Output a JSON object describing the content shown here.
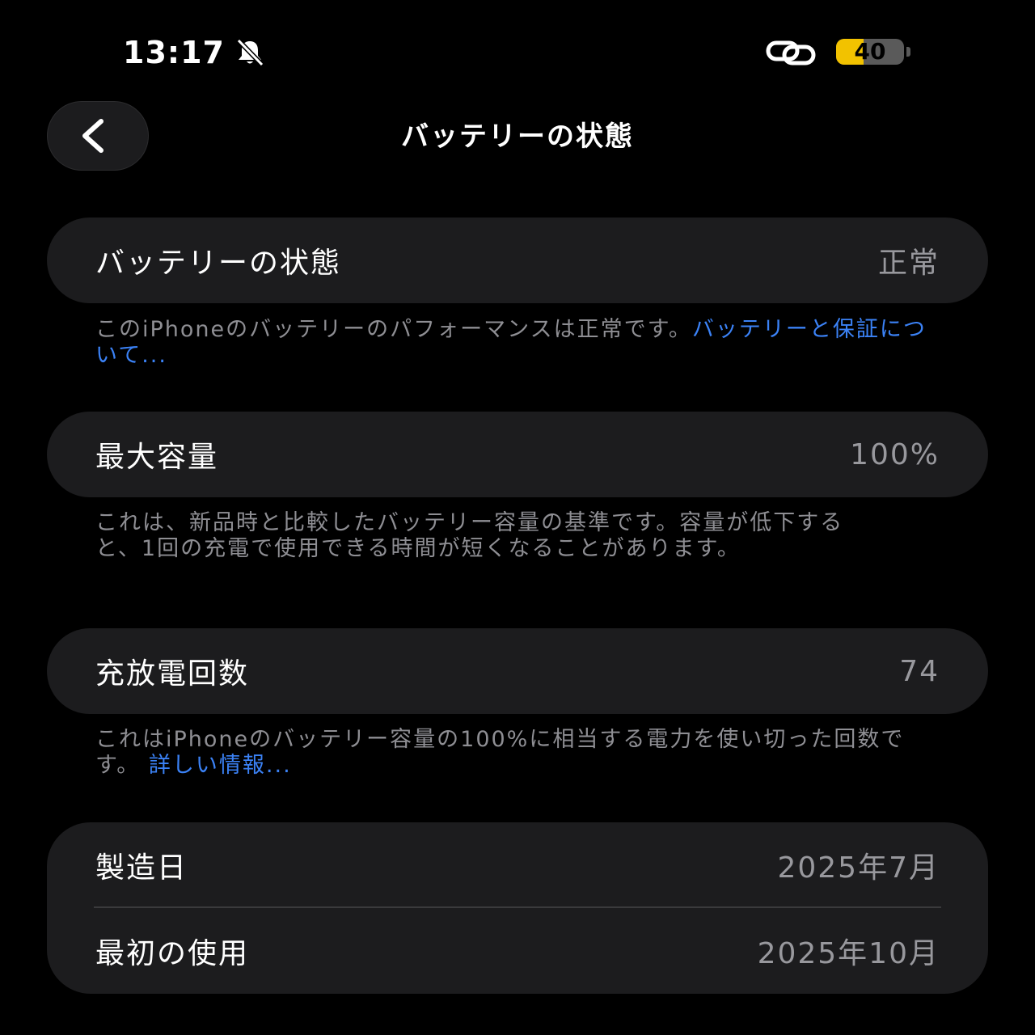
{
  "status_bar": {
    "time": "13:17",
    "battery_level": "40",
    "battery_fraction": 0.4,
    "icons": [
      "bell-slash-icon",
      "link-icon",
      "battery-icon"
    ]
  },
  "nav": {
    "back_icon": "chevron-left-icon",
    "title": "バッテリーの状態"
  },
  "battery_health": {
    "label": "バッテリーの状態",
    "value": "正常",
    "footnote": "このiPhoneのバッテリーのパフォーマンスは正常です。",
    "footnote_link": "バッテリーと保証について..."
  },
  "max_capacity": {
    "label": "最大容量",
    "value": "100%",
    "footnote": "これは、新品時と比較したバッテリー容量の基準です。容量が低下すると、1回の充電で使用できる時間が短くなることがあります。"
  },
  "cycle_count": {
    "label": "充放電回数",
    "value": "74",
    "footnote": "これはiPhoneのバッテリー容量の100%に相当する電力を使い切った回数です。",
    "footnote_link": "詳しい情報..."
  },
  "dates": {
    "manufacture_label": "製造日",
    "manufacture_value": "2025年7月",
    "first_use_label": "最初の使用",
    "first_use_value": "2025年10月"
  },
  "colors": {
    "background": "#000000",
    "card": "#1c1c1e",
    "link": "#3b82f6",
    "battery_fill": "#f2c200"
  }
}
